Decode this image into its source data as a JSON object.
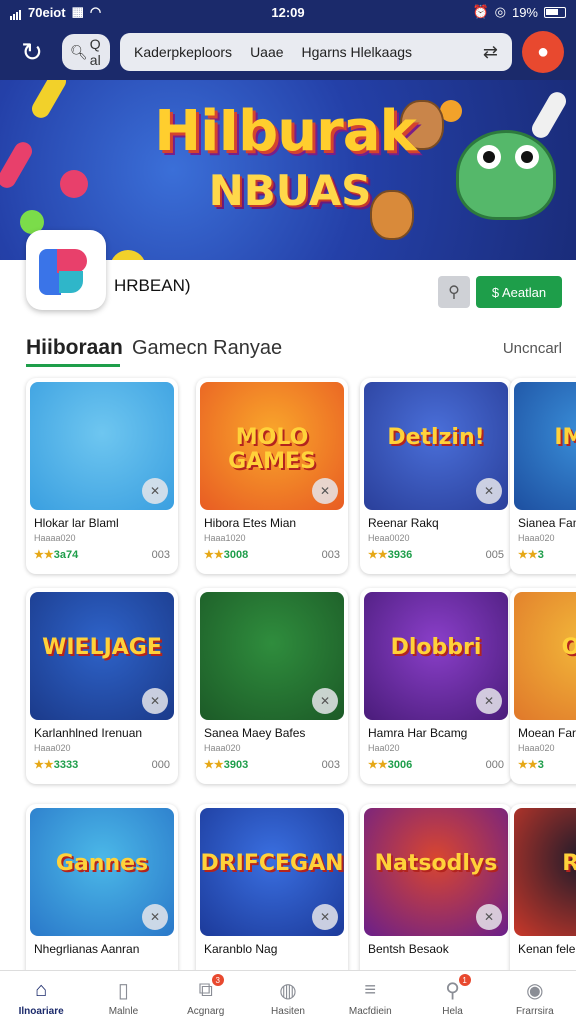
{
  "status_bar": {
    "carrier": "70eiot",
    "time": "12:09",
    "battery": "19%"
  },
  "top_nav": {
    "search_label": "Q al",
    "url_items": [
      "Kaderpkeploors",
      "Uaae",
      "Hgarns Hlelkaags"
    ]
  },
  "banner": {
    "title": "HiIburak",
    "subtitle": "NBUAS"
  },
  "app_info": {
    "name": "HRBEAN)",
    "install_label": "$ Aeatlan"
  },
  "section": {
    "title": "Hiiboraan",
    "subtitle": "Gamecn Ranyae",
    "link": "Uncncarl"
  },
  "cards": [
    {
      "title": "Hlokar lar Blaml",
      "dev": "Haaaa020",
      "rating": "3a74",
      "count": "003",
      "art_label": "",
      "colors": [
        "#6ec6f0",
        "#3a9fe0"
      ]
    },
    {
      "title": "Hibora Etes Mian",
      "dev": "Haaa1020",
      "rating": "3008",
      "count": "003",
      "art_label": "MOLO GAMES",
      "colors": [
        "#f9a62b",
        "#e85c23"
      ]
    },
    {
      "title": "Reenar Rakq",
      "dev": "Heaa0020",
      "rating": "3936",
      "count": "005",
      "art_label": "Detlzin!",
      "colors": [
        "#4a6fd9",
        "#2a3f9a"
      ]
    },
    {
      "title": "Sianea Fanl",
      "dev": "Haaa020",
      "rating": "3",
      "count": "",
      "art_label": "IMCA",
      "colors": [
        "#3a8fd9",
        "#1d4fa0"
      ]
    },
    {
      "title": "Karlanhlned Irenuan",
      "dev": "Haaa020",
      "rating": "3333",
      "count": "000",
      "art_label": "WIELJAGE",
      "colors": [
        "#2e63c9",
        "#1b3a8a"
      ]
    },
    {
      "title": "Sanea Maey Bafes",
      "dev": "Haaa020",
      "rating": "3903",
      "count": "003",
      "art_label": "",
      "colors": [
        "#2f8d3d",
        "#1c5a27"
      ]
    },
    {
      "title": "Hamra Har Bcamg",
      "dev": "Haa020",
      "rating": "3006",
      "count": "000",
      "art_label": "Dlobbri",
      "colors": [
        "#8a3fc9",
        "#4a1c7a"
      ]
    },
    {
      "title": "Moean Farl",
      "dev": "Haaa020",
      "rating": "3",
      "count": "",
      "art_label": "Ooa",
      "colors": [
        "#f2b83a",
        "#e0782a"
      ]
    },
    {
      "title": "Nhegrlianas Aanran",
      "dev": "",
      "rating": "",
      "count": "",
      "art_label": "Gannes",
      "colors": [
        "#4bb8e8",
        "#2a78c9"
      ]
    },
    {
      "title": "Karanblo Nag",
      "dev": "",
      "rating": "",
      "count": "",
      "art_label": "DRIFCEGAN",
      "colors": [
        "#3a6fe0",
        "#1c3a9a"
      ]
    },
    {
      "title": "Bentsh Besaok",
      "dev": "",
      "rating": "",
      "count": "",
      "art_label": "Natsodlys",
      "colors": [
        "#d9462f",
        "#6a1f8a"
      ]
    },
    {
      "title": "Kenan fele",
      "dev": "",
      "rating": "",
      "count": "",
      "art_label": "Ran",
      "colors": [
        "#1a1a2a",
        "#c9382a"
      ]
    }
  ],
  "bottom_nav": [
    {
      "label": "Ilnoariare",
      "icon": "home-icon",
      "active": true
    },
    {
      "label": "Malnle",
      "icon": "bookmark-icon",
      "active": false
    },
    {
      "label": "Acgnarg",
      "icon": "gift-icon",
      "active": false,
      "badge": "3"
    },
    {
      "label": "Hasiten",
      "icon": "globe-icon",
      "active": false
    },
    {
      "label": "Macfdiein",
      "icon": "menu-icon",
      "active": false
    },
    {
      "label": "Hela",
      "icon": "search-icon",
      "active": false,
      "badge": "1"
    },
    {
      "label": "Frarrsira",
      "icon": "account-icon",
      "active": false
    }
  ]
}
